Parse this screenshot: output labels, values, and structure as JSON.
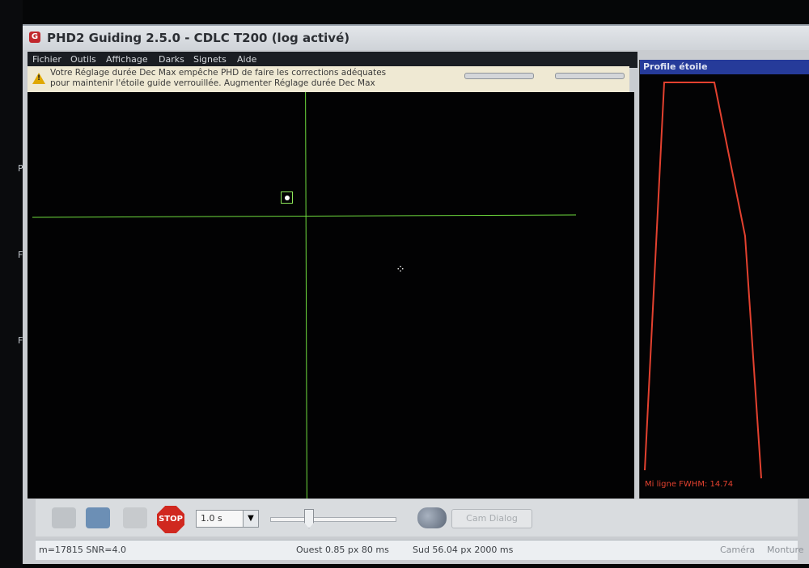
{
  "window": {
    "title": "PHD2 Guiding 2.5.0 - CDLC T200 (log activé)",
    "app_icon_letter": "G"
  },
  "side_labels": [
    "Po",
    "Fic",
    "Fa"
  ],
  "menu": [
    "Fichier",
    "Outils",
    "Affichage",
    "Darks",
    "Signets",
    "Aide"
  ],
  "alert": {
    "line1": "Votre Réglage durée Dec Max empêche PHD de faire les corrections adéquates",
    "line2": "pour maintenir l'étoile guide verrouillée. Augmenter Réglage durée Dec Max",
    "icon": "warning-icon"
  },
  "profile": {
    "title": "Profile étoile",
    "footer": "Mi ligne   FWHM: 14.74",
    "line_color": "#e3412f"
  },
  "toolbar": {
    "exposure": "1.0 s",
    "cam_dialog_label": "Cam Dialog",
    "stop_label": "STOP"
  },
  "status": {
    "star": "m=17815 SNR=4.0",
    "west": "Ouest  0.85 px  80 ms",
    "south": "Sud 56.04 px 2000 ms",
    "camera": "Caméra",
    "mount": "Monture"
  },
  "colors": {
    "guide_lines": "#6fdc3e",
    "alert_bg": "#efe9d3",
    "profile_header": "#263b9a"
  }
}
